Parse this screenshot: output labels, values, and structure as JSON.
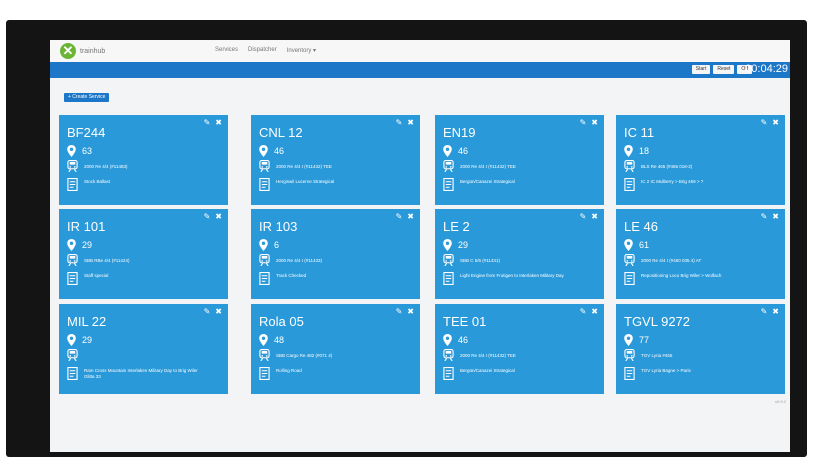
{
  "brand": {
    "name": "trainhub"
  },
  "nav": [
    "Services",
    "Dispatcher",
    "Inventory ▾"
  ],
  "topbar": {
    "buttons": [
      "Start",
      "Reset",
      "Off"
    ],
    "clock": "00:04:29"
  },
  "create_button": "+ Create Service",
  "cards": [
    {
      "title": "BF244",
      "location": "63",
      "loco": "2000 Re 4/4 (#11483)",
      "note": "Stock Ballast"
    },
    {
      "title": "CNL 12",
      "location": "46",
      "loco": "2000 Re 4/4 I (#11432) TEE",
      "note": "Hergiswil Lucerne Strategical"
    },
    {
      "title": "EN19",
      "location": "46",
      "loco": "2000 Re 4/4 I (#11432) TEE",
      "note": "Bergün/Canazei Strategical"
    },
    {
      "title": "IC 11",
      "location": "18",
      "loco": "BLS Re 465 (#465 018-2)",
      "note": "IC 2 IC Mulberry > Brig 459 > ?"
    },
    {
      "title": "IR 101",
      "location": "29",
      "loco": "SBB RBe 4/4 (#11424)",
      "note": "Staff special"
    },
    {
      "title": "IR 103",
      "location": "6",
      "loco": "2000 Re 4/4 I (#11433)",
      "note": "Track Checked"
    },
    {
      "title": "LE 2",
      "location": "29",
      "loco": "SBB C 5/6 (#11431)",
      "note": "Light Engine from Frutigen to Interlaken Military Day"
    },
    {
      "title": "LE 46",
      "location": "61",
      "loco": "2000 Re 4/4 I (#460 035 4) AT",
      "note": "Repositioning Loco Brig Wiler > Wolfach"
    },
    {
      "title": "MIL 22",
      "location": "29",
      "loco": "",
      "note": "Ram Cross Mountain Interlaken Military Day to Brig Wiler Glitta 33"
    },
    {
      "title": "Rola 05",
      "location": "48",
      "loco": "SBB Cargo Re 482 (#071 4)",
      "note": "Rolling Road"
    },
    {
      "title": "TEE 01",
      "location": "46",
      "loco": "2000 Re 4/4 I (#11432) TEE",
      "note": "Bergün/Canazei Strategical"
    },
    {
      "title": "TGVL 9272",
      "location": "77",
      "loco": "TGV Lyria #455",
      "note": "TGV Lyria Bagne > Paris"
    }
  ],
  "footer_note": "v0.9.2",
  "colors": {
    "accent": "#1d77c8",
    "card": "#2a99d9",
    "brand_green": "#6bb536"
  },
  "icons": [
    "map-pin-icon",
    "train-icon",
    "document-icon",
    "pencil-icon",
    "close-icon"
  ]
}
